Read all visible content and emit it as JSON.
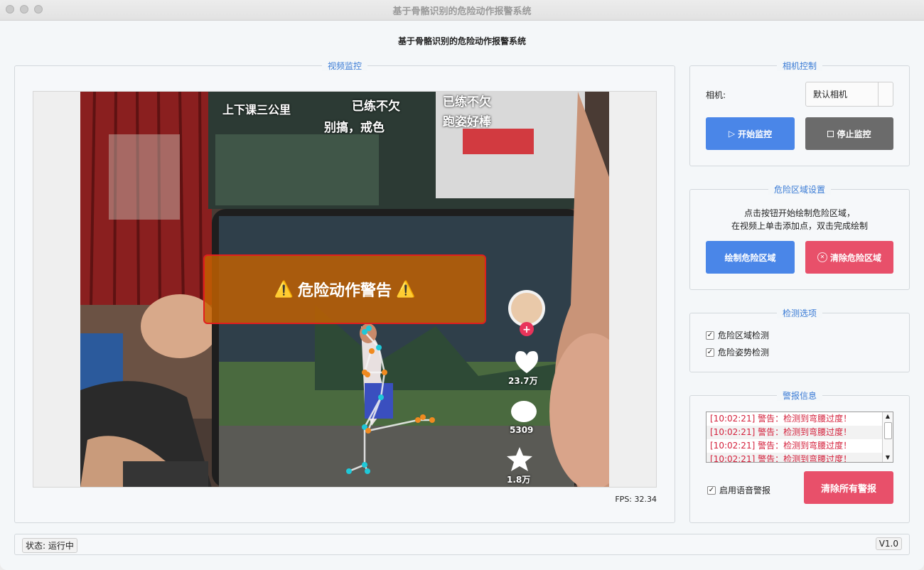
{
  "window": {
    "title": "基于骨骼识别的危险动作报警系统"
  },
  "app": {
    "title": "基于骨骼识别的危险动作报警系统"
  },
  "video_group": {
    "title": "视频监控",
    "fps_label": "FPS: 32.34",
    "warning_text": "危险动作警告",
    "warning_icon": "warning-triangle-icon",
    "overlay_texts": [
      "上下课三公里",
      "已练不欠",
      "已练不欠",
      "别搞，戒色",
      "跑姿好棒",
      "23.7万",
      "5309",
      "1.8万"
    ]
  },
  "camera_group": {
    "title": "相机控制",
    "camera_label": "相机:",
    "camera_selected": "默认相机",
    "start_label": "开始监控",
    "stop_label": "停止监控"
  },
  "zone_group": {
    "title": "危险区域设置",
    "hint_line1": "点击按钮开始绘制危险区域，",
    "hint_line2": "在视频上单击添加点，双击完成绘制",
    "draw_label": "绘制危险区域",
    "clear_label": "清除危险区域"
  },
  "detect_group": {
    "title": "检测选项",
    "options": [
      {
        "label": "危险区域检测",
        "checked": true
      },
      {
        "label": "危险姿势检测",
        "checked": true
      }
    ]
  },
  "alert_group": {
    "title": "警报信息",
    "alerts": [
      "[10:02:21] 警告：检测到弯腰过度！",
      "[10:02:21] 警告：检测到弯腰过度！",
      "[10:02:21] 警告：检测到弯腰过度！",
      "[10:02:21] 警告：检测到弯腰过度！"
    ],
    "voice_label": "启用语音警报",
    "voice_checked": true,
    "clear_all_label": "清除所有警报"
  },
  "statusbar": {
    "status": "状态: 运行中",
    "version": "V1.0"
  },
  "colors": {
    "accent": "#4a86e8",
    "danger": "#e8506a",
    "gray_button": "#6b6b6b",
    "alert_text": "#d4213c",
    "group_title": "#3a7bd5"
  }
}
